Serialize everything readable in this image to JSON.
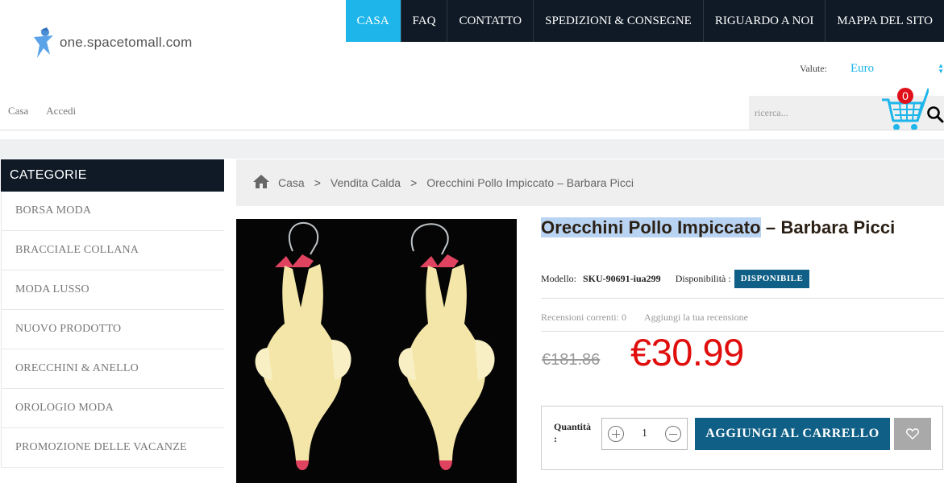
{
  "header": {
    "logo_text": "one.spacetomall.com",
    "nav": [
      "CASA",
      "FAQ",
      "CONTATTO",
      "SPEDIZIONI & CONSEGNE",
      "RIGUARDO A NOI",
      "MAPPA DEL SITO"
    ],
    "active_nav": "CASA",
    "currency_label": "Valute:",
    "currency_value": "Euro",
    "user_links": [
      "Casa",
      "Accedi"
    ],
    "search_placeholder": "ricerca...",
    "cart_count": "0",
    "accent_color": "#1eb6ea",
    "dark_color": "#0f1a26"
  },
  "sidebar": {
    "title": "CATEGORIE",
    "items": [
      "BORSA MODA",
      "BRACCIALE COLLANA",
      "MODA LUSSO",
      "NUOVO PRODOTTO",
      "ORECCHINI & ANELLO",
      "OROLOGIO MODA",
      "PROMOZIONE DELLE VACANZE"
    ]
  },
  "breadcrumb": [
    "Casa",
    "Vendita Calda",
    "Orecchini Pollo Impiccato – Barbara Picci"
  ],
  "product": {
    "title_highlight": "Orecchini Pollo Impiccato",
    "title_rest": " – Barbara Picci",
    "model_label": "Modello:",
    "model_value": "SKU-90691-iua299",
    "availability_label": "Disponibilità :",
    "availability_value": "DISPONIBILE",
    "reviews_label": "Recensioni correnti: 0",
    "add_review": "Aggiungi la tua recensione",
    "old_price": "€181.86",
    "new_price": "€30.99",
    "quantity_label": "Quantità :",
    "quantity_value": "1",
    "add_to_cart": "AGGIUNGI AL CARRELLO",
    "price_color": "#e00d0d",
    "button_color": "#0f5f86"
  }
}
